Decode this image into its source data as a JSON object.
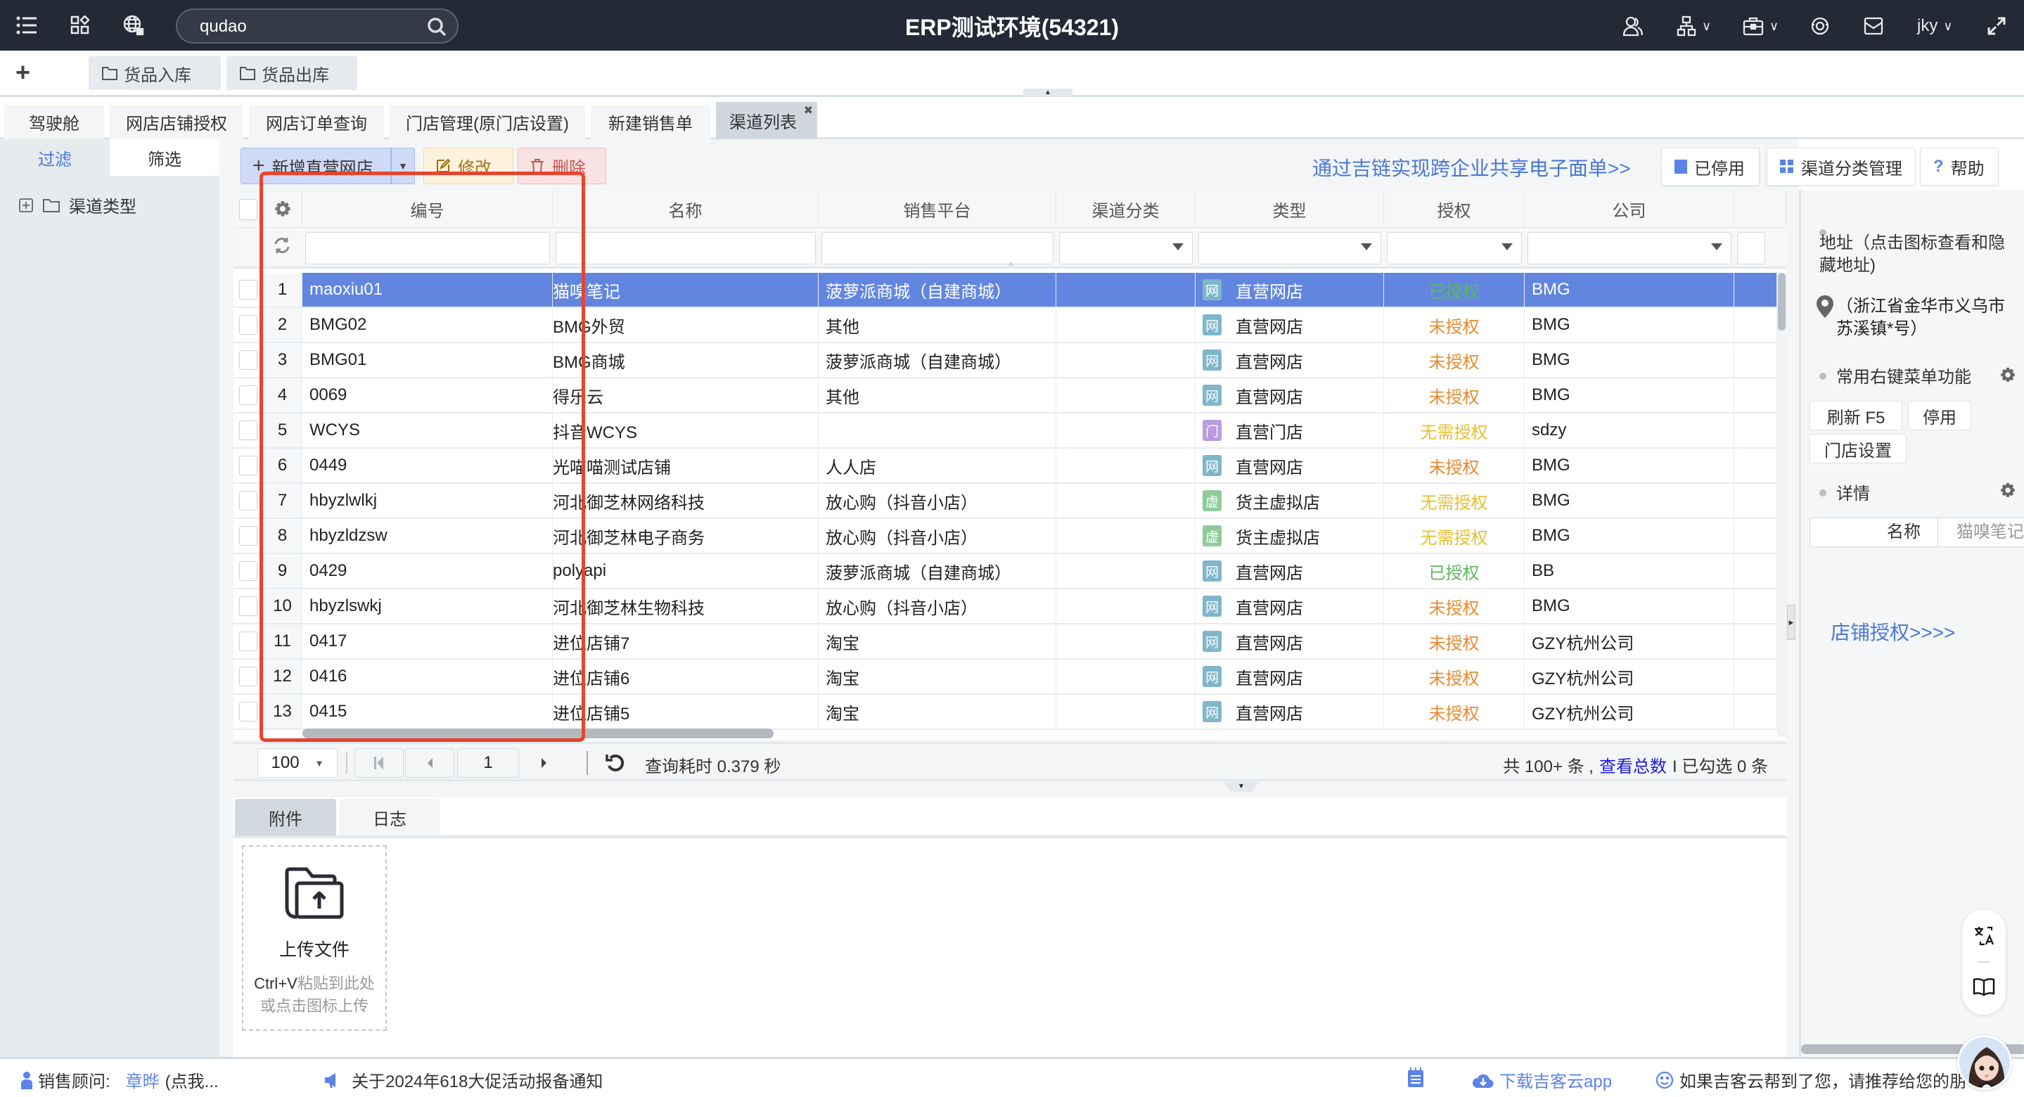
{
  "topbar": {
    "title": "ERP测试环境(54321)",
    "search_value": "qudao",
    "user": "jky",
    "icons": [
      "menu-icon",
      "apps-icon",
      "globe-icon",
      "search-icon",
      "contacts-icon",
      "org-icon",
      "briefcase-icon",
      "support-icon",
      "mail-icon",
      "fullscreen-icon"
    ]
  },
  "quickbar": {
    "add": "+",
    "shortcuts": [
      "货品入库",
      "货品出库"
    ]
  },
  "tabs": [
    {
      "label": "驾驶舱",
      "active": false
    },
    {
      "label": "网店店铺授权",
      "active": false
    },
    {
      "label": "网店订单查询",
      "active": false
    },
    {
      "label": "门店管理(原门店设置)",
      "active": false
    },
    {
      "label": "新建销售单",
      "active": false
    },
    {
      "label": "渠道列表",
      "active": true,
      "closable": true
    }
  ],
  "sidebar": {
    "tabs": [
      "过滤",
      "筛选"
    ],
    "active_tab": "过滤",
    "tree": [
      {
        "label": "渠道类型"
      }
    ]
  },
  "toolbar": {
    "add_label": "新增直营网店",
    "edit_label": "修改",
    "delete_label": "删除",
    "promo_link": "通过吉链实现跨企业共享电子面单>>",
    "disabled_label": "已停用",
    "category_label": "渠道分类管理",
    "help_label": "帮助"
  },
  "grid": {
    "columns": [
      "编号",
      "名称",
      "销售平台",
      "渠道分类",
      "类型",
      "授权",
      "公司"
    ],
    "selected_row": 1,
    "rows": [
      {
        "n": "1",
        "code": "maoxiu01",
        "name": "猫嗅笔记",
        "platform": "菠萝派商城（自建商城）",
        "category": "",
        "type": "直营网店",
        "type_badge": "网",
        "auth": "已授权",
        "company": "BMG"
      },
      {
        "n": "2",
        "code": "BMG02",
        "name": "BMG外贸",
        "platform": "其他",
        "category": "",
        "type": "直营网店",
        "type_badge": "网",
        "auth": "未授权",
        "company": "BMG"
      },
      {
        "n": "3",
        "code": "BMG01",
        "name": "BMG商城",
        "platform": "菠萝派商城（自建商城）",
        "category": "",
        "type": "直营网店",
        "type_badge": "网",
        "auth": "未授权",
        "company": "BMG"
      },
      {
        "n": "4",
        "code": "0069",
        "name": "得乐云",
        "platform": "其他",
        "category": "",
        "type": "直营网店",
        "type_badge": "网",
        "auth": "未授权",
        "company": "BMG"
      },
      {
        "n": "5",
        "code": "WCYS",
        "name": "抖音WCYS",
        "platform": "",
        "category": "",
        "type": "直营门店",
        "type_badge": "门",
        "auth": "无需授权",
        "company": "sdzy"
      },
      {
        "n": "6",
        "code": "0449",
        "name": "光喵喵测试店铺",
        "platform": "人人店",
        "category": "",
        "type": "直营网店",
        "type_badge": "网",
        "auth": "未授权",
        "company": "BMG"
      },
      {
        "n": "7",
        "code": "hbyzlwlkj",
        "name": "河北御芝林网络科技",
        "platform": "放心购（抖音小店）",
        "category": "",
        "type": "货主虚拟店",
        "type_badge": "虚",
        "auth": "无需授权",
        "company": "BMG"
      },
      {
        "n": "8",
        "code": "hbyzldzsw",
        "name": "河北御芝林电子商务",
        "platform": "放心购（抖音小店）",
        "category": "",
        "type": "货主虚拟店",
        "type_badge": "虚",
        "auth": "无需授权",
        "company": "BMG"
      },
      {
        "n": "9",
        "code": "0429",
        "name": "polyapi",
        "platform": "菠萝派商城（自建商城）",
        "category": "",
        "type": "直营网店",
        "type_badge": "网",
        "auth": "已授权",
        "company": "BB"
      },
      {
        "n": "10",
        "code": "hbyzlswkj",
        "name": "河北御芝林生物科技",
        "platform": "放心购（抖音小店）",
        "category": "",
        "type": "直营网店",
        "type_badge": "网",
        "auth": "未授权",
        "company": "BMG"
      },
      {
        "n": "11",
        "code": "0417",
        "name": "进位店铺7",
        "platform": "淘宝",
        "category": "",
        "type": "直营网店",
        "type_badge": "网",
        "auth": "未授权",
        "company": "GZY杭州公司"
      },
      {
        "n": "12",
        "code": "0416",
        "name": "进位店铺6",
        "platform": "淘宝",
        "category": "",
        "type": "直营网店",
        "type_badge": "网",
        "auth": "未授权",
        "company": "GZY杭州公司"
      },
      {
        "n": "13",
        "code": "0415",
        "name": "进位店铺5",
        "platform": "淘宝",
        "category": "",
        "type": "直营网店",
        "type_badge": "网",
        "auth": "未授权",
        "company": "GZY杭州公司"
      }
    ]
  },
  "colors": {
    "selected_row": "#6286e0",
    "authorized": "#5cb85c",
    "unauthorized": "#e58a2e",
    "not_required": "#e8be2c",
    "badge_online": "#7fb6c9",
    "badge_store": "#b99be0",
    "badge_virtual": "#8ecb9a",
    "link": "#4a78d8",
    "highlight_box": "#e8442d"
  },
  "pager": {
    "page_size": "100",
    "current_page": "1",
    "query_time": "查询耗时 0.379 秒",
    "total_prefix": "共 100+ 条 ,",
    "view_total_link": "查看总数",
    "selected_suffix": "I 已勾选 0 条"
  },
  "bottom": {
    "tabs": [
      "附件",
      "日志"
    ],
    "active_tab": "附件",
    "upload_title": "上传文件",
    "upload_hint_bold": "Ctrl+V",
    "upload_hint_1": "粘贴到此处",
    "upload_hint_2": "或点击图标上传"
  },
  "right_panel": {
    "address_title": "地址（点击图标查看和隐藏地址)",
    "address_value": "（浙江省金华市义乌市苏溪镇*号）",
    "menu_title": "常用右键菜单功能",
    "menu_buttons": [
      "刷新  F5",
      "停用",
      "门店设置"
    ],
    "detail_title": "详情",
    "detail_label": "名称",
    "detail_value": "猫嗅笔记",
    "auth_link": "店铺授权>>>>"
  },
  "status": {
    "advisor_label": "销售顾问:",
    "advisor_name": "章晔",
    "advisor_hint": "(点我...",
    "notice": "关于2024年618大促活动报备通知",
    "download_app": "下载吉客云app",
    "recommend": "如果吉客云帮到了您，请推荐给您的朋"
  }
}
